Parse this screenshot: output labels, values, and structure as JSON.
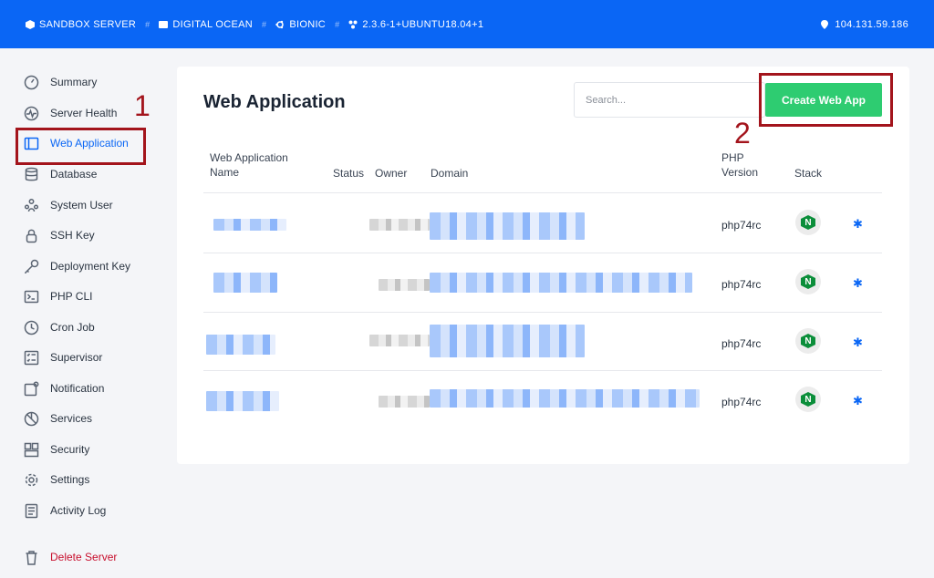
{
  "topbar": {
    "server": "SANDBOX SERVER",
    "provider": "DIGITAL OCEAN",
    "os": "BIONIC",
    "version": "2.3.6-1+UBUNTU18.04+1",
    "ip": "104.131.59.186",
    "separator": "#"
  },
  "sidebar": {
    "items": [
      {
        "label": "Summary",
        "icon": "gauge-icon"
      },
      {
        "label": "Server Health",
        "icon": "pulse-icon"
      },
      {
        "label": "Web Application",
        "icon": "window-icon"
      },
      {
        "label": "Database",
        "icon": "database-icon"
      },
      {
        "label": "System User",
        "icon": "users-icon"
      },
      {
        "label": "SSH Key",
        "icon": "lock-icon"
      },
      {
        "label": "Deployment Key",
        "icon": "key-icon"
      },
      {
        "label": "PHP CLI",
        "icon": "terminal-icon"
      },
      {
        "label": "Cron Job",
        "icon": "clock-icon"
      },
      {
        "label": "Supervisor",
        "icon": "checklist-icon"
      },
      {
        "label": "Notification",
        "icon": "bell-icon"
      },
      {
        "label": "Services",
        "icon": "services-icon"
      },
      {
        "label": "Security",
        "icon": "shield-icon"
      },
      {
        "label": "Settings",
        "icon": "gear-icon"
      },
      {
        "label": "Activity Log",
        "icon": "log-icon"
      }
    ],
    "delete_label": "Delete Server",
    "active": "Web Application"
  },
  "main": {
    "title": "Web Application",
    "search_placeholder": "Search...",
    "create_label": "Create Web App",
    "columns": {
      "name": "Web Application Name",
      "status": "Status",
      "owner": "Owner",
      "domain": "Domain",
      "php": "PHP Version",
      "stack": "Stack"
    },
    "rows": [
      {
        "php": "php74rc",
        "stack": "N"
      },
      {
        "php": "php74rc",
        "stack": "N"
      },
      {
        "php": "php74rc",
        "stack": "N"
      },
      {
        "php": "php74rc",
        "stack": "N"
      }
    ]
  },
  "annotations": {
    "one": "1",
    "two": "2"
  },
  "colors": {
    "accent": "#0a66f5",
    "success": "#2ecc71",
    "danger": "#c8102e",
    "annotation": "#a3141c"
  }
}
